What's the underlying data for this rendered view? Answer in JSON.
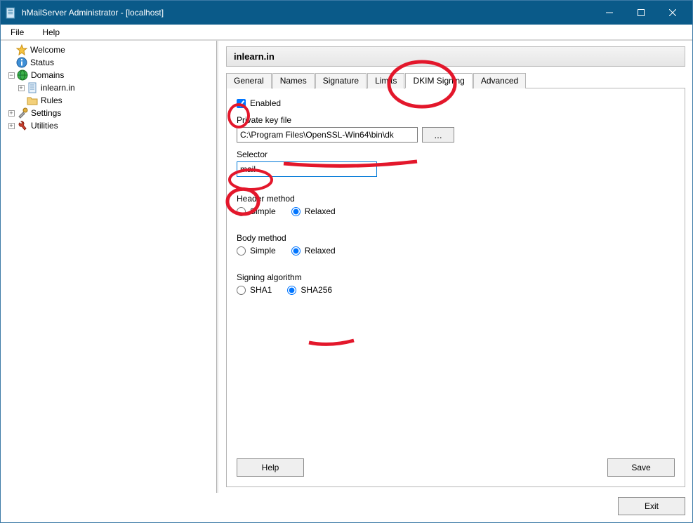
{
  "window": {
    "title": "hMailServer Administrator - [localhost]"
  },
  "menubar": {
    "file": "File",
    "help": "Help"
  },
  "tree": {
    "welcome": "Welcome",
    "status": "Status",
    "domains": "Domains",
    "domain_item": "inlearn.in",
    "rules": "Rules",
    "settings": "Settings",
    "utilities": "Utilities"
  },
  "panel": {
    "title": "inlearn.in"
  },
  "tabs": {
    "general": "General",
    "names": "Names",
    "signature": "Signature",
    "limits": "Limits",
    "dkim": "DKIM Signing",
    "advanced": "Advanced"
  },
  "form": {
    "enabled_label": "Enabled",
    "enabled_checked": true,
    "pkf_label": "Private key file",
    "pkf_value": "C:\\Program Files\\OpenSSL-Win64\\bin\\dk",
    "browse_label": "...",
    "selector_label": "Selector",
    "selector_value": "mail",
    "header_label": "Header method",
    "body_label": "Body method",
    "algo_label": "Signing algorithm",
    "opt_simple": "Simple",
    "opt_relaxed": "Relaxed",
    "opt_sha1": "SHA1",
    "opt_sha256": "SHA256"
  },
  "buttons": {
    "help": "Help",
    "save": "Save",
    "exit": "Exit"
  }
}
